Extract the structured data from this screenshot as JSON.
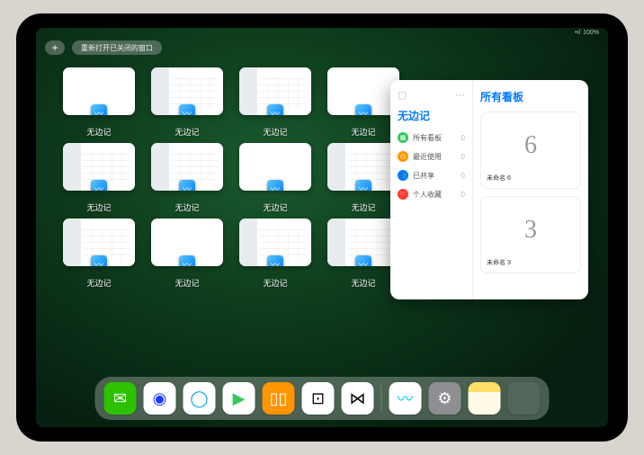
{
  "status": {
    "signal": "•ıl",
    "wifi": "⋮",
    "battery": "100%"
  },
  "topbar": {
    "plus": "+",
    "reopen_label": "重新打开已关闭的窗口"
  },
  "thumbnails": [
    {
      "label": "无边记",
      "split": false
    },
    {
      "label": "无边记",
      "split": true
    },
    {
      "label": "无边记",
      "split": true
    },
    {
      "label": "无边记",
      "split": false
    },
    {
      "label": "无边记",
      "split": true
    },
    {
      "label": "无边记",
      "split": true
    },
    {
      "label": "无边记",
      "split": false
    },
    {
      "label": "无边记",
      "split": true
    },
    {
      "label": "无边记",
      "split": true
    },
    {
      "label": "无边记",
      "split": false
    },
    {
      "label": "无边记",
      "split": true
    },
    {
      "label": "无边记",
      "split": true
    }
  ],
  "large_window": {
    "app_icon": "▢",
    "more_icon": "⋯",
    "left_title": "无边记",
    "right_title": "所有看板",
    "items": [
      {
        "icon_color": "#34c759",
        "glyph": "▦",
        "label": "所有看板",
        "count": "0"
      },
      {
        "icon_color": "#ff9500",
        "glyph": "◷",
        "label": "最近使用",
        "count": "0"
      },
      {
        "icon_color": "#007aff",
        "glyph": "👥",
        "label": "已共享",
        "count": "0"
      },
      {
        "icon_color": "#ff3b30",
        "glyph": "♡",
        "label": "个人收藏",
        "count": "0"
      }
    ],
    "boards": [
      {
        "sketch": "6",
        "name": "未命名 6",
        "date": ""
      },
      {
        "sketch": "3",
        "name": "未命名 3",
        "date": ""
      }
    ]
  },
  "dock": {
    "apps": [
      {
        "name": "wechat",
        "bg": "#2dc100",
        "glyph": "✉"
      },
      {
        "name": "browser",
        "bg": "#ffffff",
        "glyph_color": "#1a3cff",
        "glyph": "◉"
      },
      {
        "name": "qqbrowser",
        "bg": "#ffffff",
        "glyph_color": "#00a0ff",
        "glyph": "◯"
      },
      {
        "name": "play",
        "bg": "#ffffff",
        "glyph_color": "#34c759",
        "glyph": "▶"
      },
      {
        "name": "books",
        "bg": "#ff9500",
        "glyph": "▯▯"
      },
      {
        "name": "dice",
        "bg": "#ffffff",
        "glyph_color": "#000",
        "glyph": "⊡"
      },
      {
        "name": "connect",
        "bg": "#ffffff",
        "glyph_color": "#000",
        "glyph": "⋈"
      }
    ],
    "recent": [
      {
        "name": "freeform",
        "bg": "#ffffff",
        "glyph_color": "#00c2ff",
        "glyph": "〰"
      },
      {
        "name": "settings",
        "bg": "#8e8e93",
        "glyph": "⚙"
      },
      {
        "name": "notes",
        "bg": "linear-gradient(#ffe066 0 30%, #fffbe6 30%)",
        "glyph": ""
      }
    ],
    "library_tiles": [
      "#5ac8fa",
      "#34c759",
      "#ff9500",
      "#007aff"
    ]
  }
}
